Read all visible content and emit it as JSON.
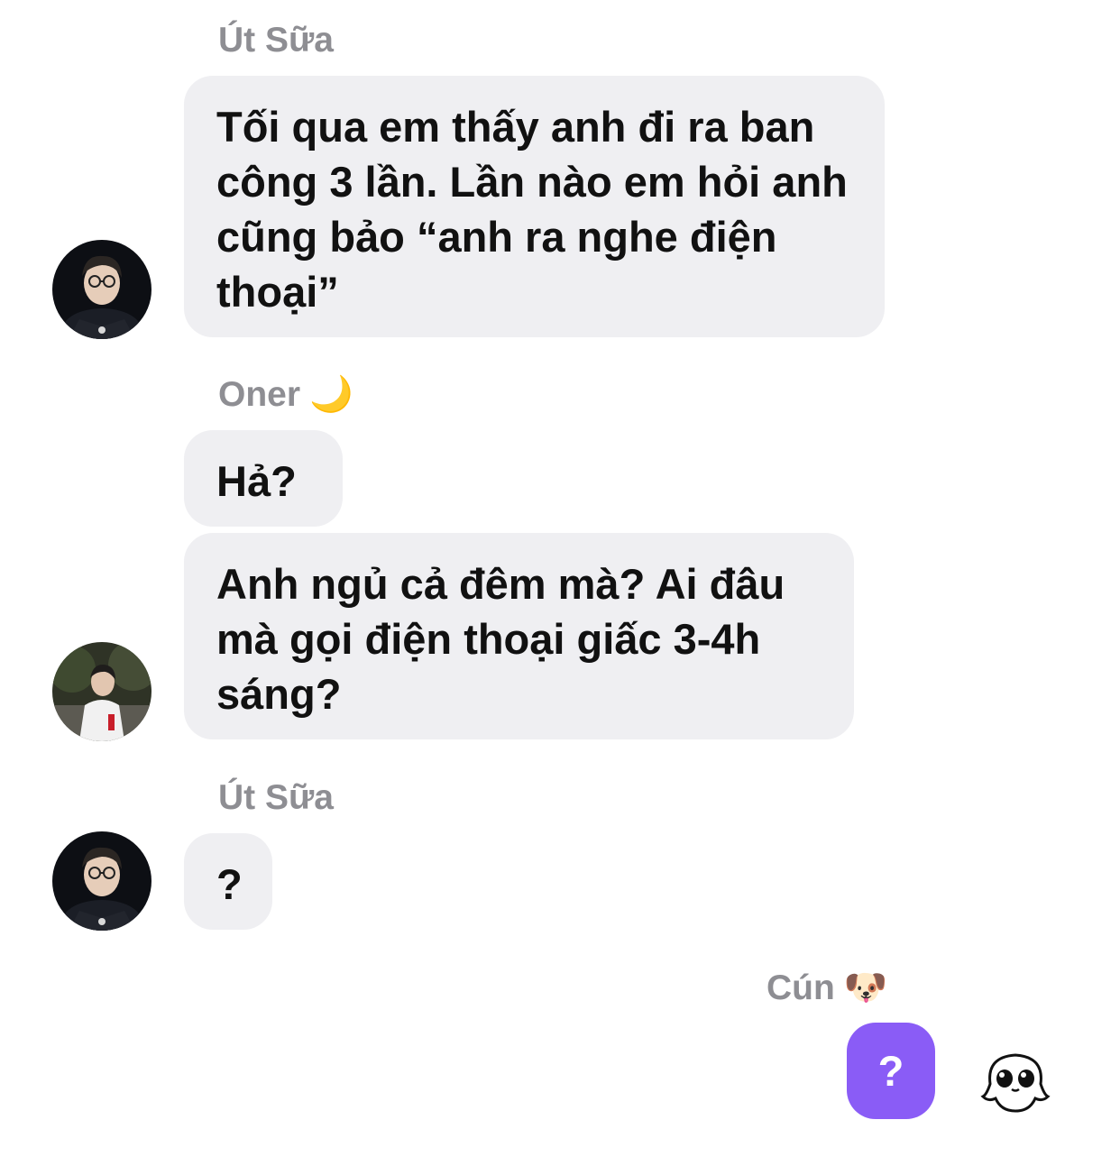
{
  "messages": [
    {
      "sender": "Út Sữa",
      "sender_emoji": "",
      "text": "Tối qua em thấy anh đi ra ban công 3 lần. Lần nào em hỏi anh cũng bảo “anh ra nghe điện thoại”"
    },
    {
      "sender": "Oner",
      "sender_emoji": "🌙",
      "text": "Hả?"
    },
    {
      "text": "Anh ngủ cả đêm mà? Ai đâu mà gọi điện thoại giấc 3-4h sáng?"
    },
    {
      "sender": "Út Sữa",
      "sender_emoji": "",
      "text": "?"
    },
    {
      "sender": "Cún",
      "sender_emoji": "🐶",
      "text": "?"
    }
  ],
  "colors": {
    "incoming_bubble": "#efeff2",
    "outgoing_bubble": "#8a5cf6",
    "sender_name": "#8e8e93"
  }
}
